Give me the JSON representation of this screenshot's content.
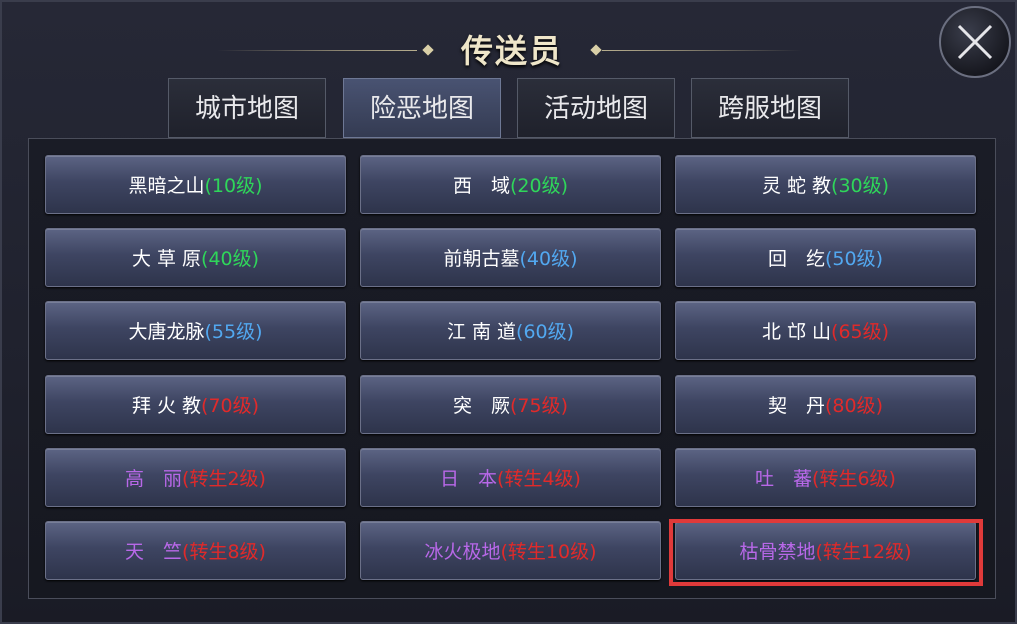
{
  "window": {
    "title": "传送员",
    "close_icon": "close-icon"
  },
  "tabs": [
    {
      "label": "城市地图",
      "active": false
    },
    {
      "label": "险恶地图",
      "active": true
    },
    {
      "label": "活动地图",
      "active": false
    },
    {
      "label": "跨服地图",
      "active": false
    }
  ],
  "maps": [
    {
      "name": "黑暗之山",
      "level": "(10级)",
      "level_color": "green",
      "name_color": "white"
    },
    {
      "name": "西　域",
      "level": "(20级)",
      "level_color": "green",
      "name_color": "white"
    },
    {
      "name": "灵 蛇 教",
      "level": "(30级)",
      "level_color": "green",
      "name_color": "white"
    },
    {
      "name": "大 草 原",
      "level": "(40级)",
      "level_color": "green",
      "name_color": "white"
    },
    {
      "name": "前朝古墓",
      "level": "(40级)",
      "level_color": "blue",
      "name_color": "white"
    },
    {
      "name": "回　纥",
      "level": "(50级)",
      "level_color": "blue",
      "name_color": "white"
    },
    {
      "name": "大唐龙脉",
      "level": "(55级)",
      "level_color": "blue",
      "name_color": "white"
    },
    {
      "name": "江 南 道",
      "level": "(60级)",
      "level_color": "blue",
      "name_color": "white"
    },
    {
      "name": "北 邙 山",
      "level": "(65级)",
      "level_color": "red",
      "name_color": "white"
    },
    {
      "name": "拜 火 教",
      "level": "(70级)",
      "level_color": "red",
      "name_color": "white"
    },
    {
      "name": "突　厥",
      "level": "(75级)",
      "level_color": "red",
      "name_color": "white"
    },
    {
      "name": "契　丹",
      "level": "(80级)",
      "level_color": "red",
      "name_color": "white"
    },
    {
      "name": "高　丽",
      "level": "(转生2级)",
      "level_color": "red",
      "name_color": "purple"
    },
    {
      "name": "日　本",
      "level": "(转生4级)",
      "level_color": "red",
      "name_color": "purple"
    },
    {
      "name": "吐　蕃",
      "level": "(转生6级)",
      "level_color": "red",
      "name_color": "purple"
    },
    {
      "name": "天　竺",
      "level": "(转生8级)",
      "level_color": "red",
      "name_color": "purple"
    },
    {
      "name": "冰火极地",
      "level": "(转生10级)",
      "level_color": "red",
      "name_color": "purple"
    },
    {
      "name": "枯骨禁地",
      "level": "(转生12级)",
      "level_color": "red",
      "name_color": "purple",
      "highlighted": true
    }
  ],
  "colors": {
    "highlight": "#e03a3a",
    "green": "#2fd65a",
    "blue": "#52a8f0",
    "red": "#e02a2a",
    "purple": "#b868e8"
  }
}
